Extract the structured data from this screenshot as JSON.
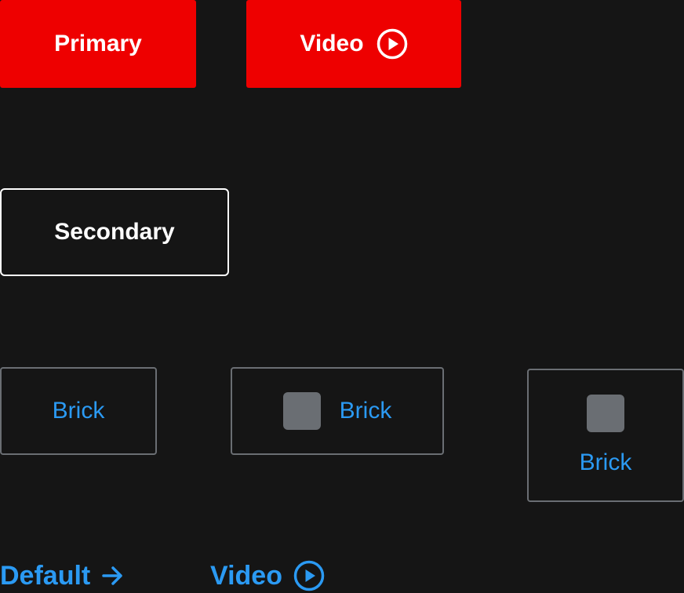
{
  "primary_row": {
    "primary_label": "Primary",
    "video_label": "Video"
  },
  "secondary": {
    "label": "Secondary"
  },
  "bricks": [
    {
      "label": "Brick",
      "icon": "none"
    },
    {
      "label": "Brick",
      "icon": "placeholder-square-icon"
    },
    {
      "label": "Brick",
      "icon": "placeholder-square-icon"
    }
  ],
  "links": {
    "default_label": "Default",
    "video_label": "Video"
  },
  "colors": {
    "background": "#151515",
    "primary_red": "#ee0000",
    "link_blue": "#2b9af3",
    "border_gray": "#6a6e73",
    "white": "#ffffff"
  }
}
